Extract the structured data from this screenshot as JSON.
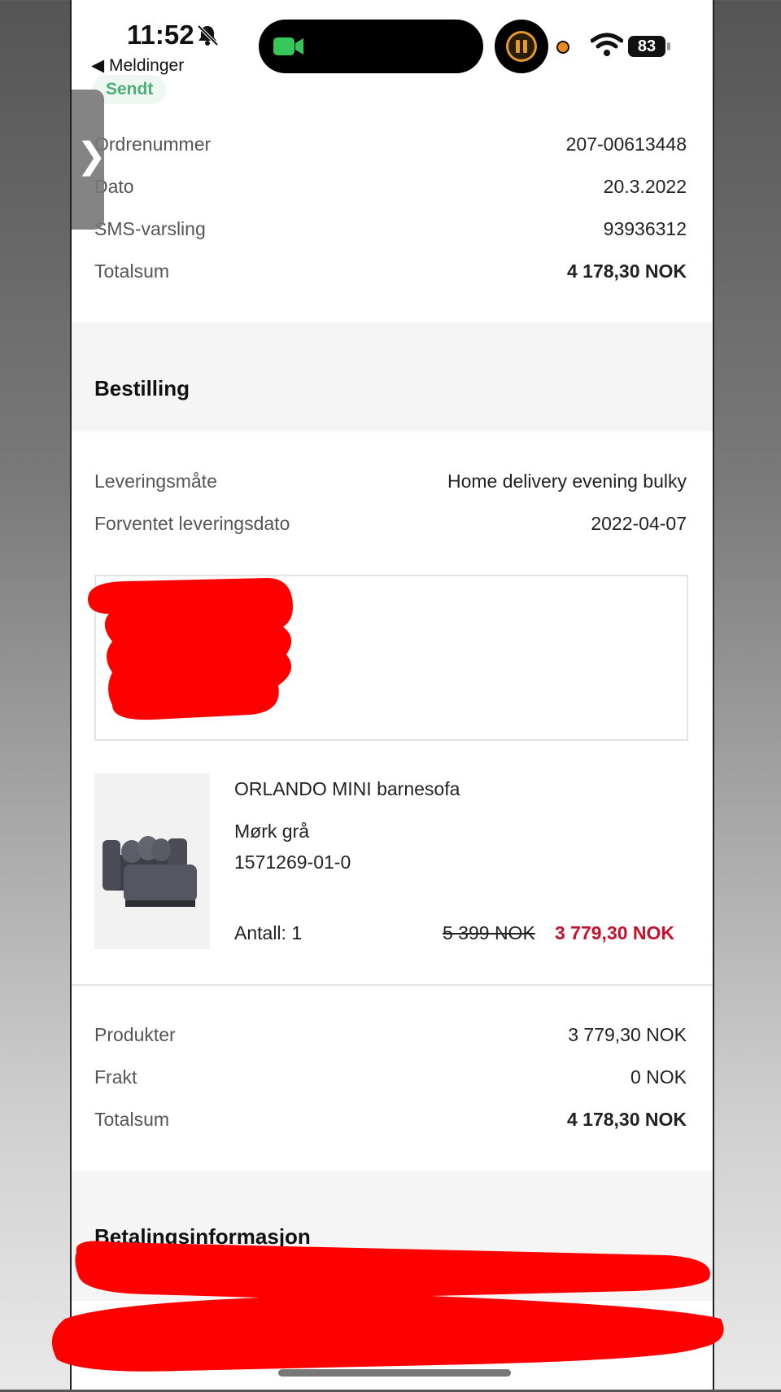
{
  "status_bar": {
    "time": "11:52",
    "back_label": "◀ Meldinger",
    "battery": "83",
    "icons": [
      "bell-slash-icon",
      "facetime-camera-icon",
      "pause-icon",
      "orange-dot-icon",
      "wifi-icon",
      "battery-icon"
    ]
  },
  "order": {
    "status_badge": "Sendt",
    "rows": [
      {
        "label": "Ordrenummer",
        "value": "207-00613448"
      },
      {
        "label": "Dato",
        "value": "20.3.2022"
      },
      {
        "label": "SMS-varsling",
        "value": "93936312"
      },
      {
        "label": "Totalsum",
        "value": "4 178,30 NOK"
      }
    ]
  },
  "bestilling": {
    "title": "Bestilling",
    "rows": [
      {
        "label": "Leveringsmåte",
        "value": "Home delivery evening bulky"
      },
      {
        "label": "Forventet leveringsdato",
        "value": "2022-04-07"
      }
    ]
  },
  "product": {
    "name": "ORLANDO MINI barnesofa",
    "color": "Mørk grå",
    "article_number": "1571269-01-0",
    "quantity": "Antall: 1",
    "old_price": "5 399 NOK",
    "new_price": "3 779,30 NOK",
    "image_icon": "sofa-icon"
  },
  "summary": {
    "rows": [
      {
        "label": "Produkter",
        "value": "3 779,30 NOK"
      },
      {
        "label": "Frakt",
        "value": "0 NOK"
      },
      {
        "label": "Totalsum",
        "value": "4 178,30 NOK"
      }
    ]
  },
  "payment": {
    "title": "Betalingsinformasjon"
  },
  "colors": {
    "accent_green": "#4caf78",
    "sale_red": "#c8102e",
    "redaction_red": "#ff0000"
  }
}
